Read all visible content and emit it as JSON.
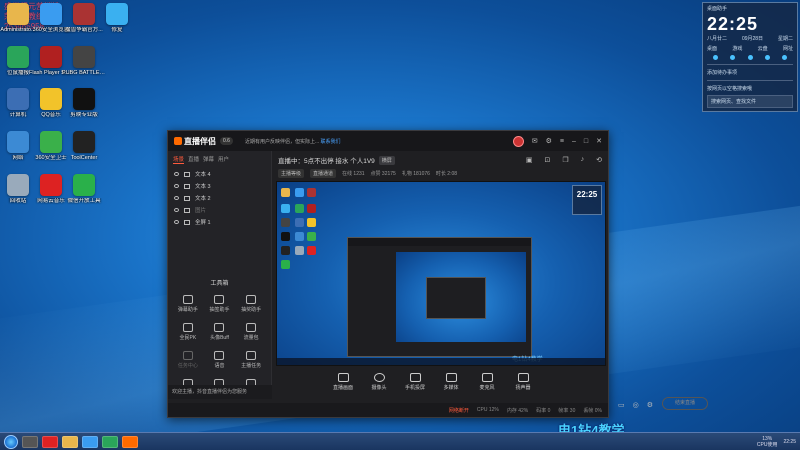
{
  "desktop": {
    "watermark_lines": [
      "盛世纪元营销推",
      "荣誉总教练",
      "253465958"
    ],
    "icons": [
      {
        "label": "Administrato...",
        "color": "#e8b64c"
      },
      {
        "label": "360安全浏览器",
        "color": "#3a9cf0"
      },
      {
        "label": "魔兽争霸官方...",
        "color": "#a33"
      },
      {
        "label": "修复",
        "color": "#3ab0f0"
      },
      {
        "label": "位鼠播报",
        "color": "#2aa55a"
      },
      {
        "label": "Flash Player Setup",
        "color": "#b02020"
      },
      {
        "label": "PUBG BATTLEGR...",
        "color": "#444"
      },
      {
        "label": "计算机",
        "color": "#3c6eb4"
      },
      {
        "label": "QQ音乐",
        "color": "#f2c32a"
      },
      {
        "label": "剪映专业版",
        "color": "#111"
      },
      {
        "label": "网络",
        "color": "#3c8ad4"
      },
      {
        "label": "360安全卫士",
        "color": "#3ab04a"
      },
      {
        "label": "ToolCenter",
        "color": "#222"
      },
      {
        "label": "回收站",
        "color": "#9ab"
      },
      {
        "label": "网易云音乐",
        "color": "#d22"
      },
      {
        "label": "微信开放工具",
        "color": "#2ab04a"
      }
    ]
  },
  "widget": {
    "title": "桌面助手",
    "time": "22:25",
    "lunar": "八月廿二",
    "date": "09月28日",
    "weekday": "星期二",
    "links": [
      "桌面",
      "游戏",
      "云盘",
      "网址"
    ],
    "item1": "添加待办事项",
    "item2": "按网页以空格搜索哦",
    "search_placeholder": "搜索网页、查找文件"
  },
  "app": {
    "logo": "直播伴侣",
    "version": "0.6",
    "notice": "近期有用户反映伴侣，但实际上...",
    "notice_link": "联系我们",
    "left_tabs": [
      "场景",
      "直播",
      "弹幕",
      "用户"
    ],
    "sources": [
      {
        "label": "文本 4",
        "dim": false
      },
      {
        "label": "文本 3",
        "dim": false
      },
      {
        "label": "文本 2",
        "dim": false
      },
      {
        "label": "图片",
        "dim": true
      },
      {
        "label": "全屏 1",
        "dim": false
      }
    ],
    "toolbox_title": "工具箱",
    "tools": [
      {
        "label": "弹幕助手",
        "dim": false
      },
      {
        "label": "抽签助手",
        "dim": false
      },
      {
        "label": "抽奖助手",
        "dim": false
      },
      {
        "label": "全民PK",
        "dim": false
      },
      {
        "label": "头像Buff",
        "dim": false
      },
      {
        "label": "流量包",
        "dim": false
      },
      {
        "label": "任务中心",
        "dim": true
      },
      {
        "label": "语音",
        "dim": false
      },
      {
        "label": "主播任务",
        "dim": false
      },
      {
        "label": "投票",
        "dim": false
      },
      {
        "label": "礼物",
        "dim": false
      },
      {
        "label": "更多",
        "dim": false
      }
    ],
    "left_footer": "欢迎主播，抖音直播伴侣为您服务",
    "room_title": "直播中：5点不出停 接水 个人1V9",
    "room_tag": "横屏",
    "room_sub_pill1": "主播等级",
    "room_sub_pill2": "直播通道",
    "room_stats": [
      "在线 1231",
      "点赞 32175",
      "礼物 181076",
      "时长 2:08"
    ],
    "controls": [
      "直播画面",
      "摄像头",
      "手机投屏",
      "多媒体",
      "麦克风",
      "扬声器"
    ],
    "golive_label": "结束直播",
    "status_left": "",
    "status_items": [
      "CPU 12%",
      "内存 42%",
      "码率 0",
      "帧率 30",
      "丢帧 0%"
    ],
    "status_warn": "网络断开"
  },
  "preview": {
    "clock": "22:25",
    "watermark": "电1钻4教学"
  },
  "taskbar": {
    "cpu_label": "CPU使用",
    "cpu_value": "13%",
    "time": "22:25"
  },
  "bottom_watermark": "电1钻4教学"
}
